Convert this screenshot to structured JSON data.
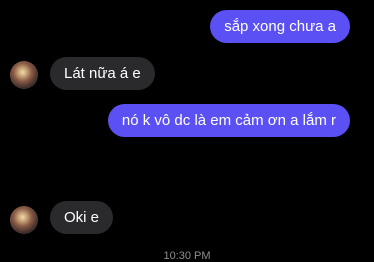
{
  "messages": [
    {
      "direction": "out",
      "text": "sắp xong chưa a"
    },
    {
      "direction": "in",
      "text": "Lát nữa á e"
    },
    {
      "direction": "out",
      "text": "nó k vô dc là em cảm ơn a lắm r"
    },
    {
      "direction": "out",
      "emoji": "😔"
    },
    {
      "direction": "in",
      "text": "Oki e"
    }
  ],
  "timestamp": "10:30 PM"
}
